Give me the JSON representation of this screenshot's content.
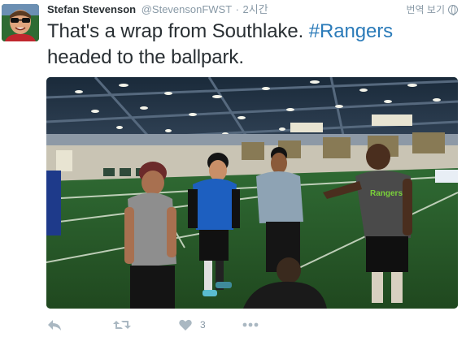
{
  "tweet": {
    "author_name": "Stefan Stevenson",
    "author_handle": "@StevensonFWST",
    "separator": "·",
    "timestamp": "2시간",
    "translate_label": "번역 보기",
    "text_part1": "That's a wrap from Southlake. ",
    "hashtag": "#Rangers",
    "text_part2": "headed to the ballpark.",
    "shirt_text": "Rangers"
  },
  "actions": {
    "reply_icon": "reply-icon",
    "retweet_icon": "retweet-icon",
    "like_icon": "heart-icon",
    "like_count": "3",
    "more_icon": "more-icon"
  },
  "colors": {
    "text": "#292f33",
    "secondary": "#8899a6",
    "hashtag": "#2b7bb9",
    "action_icon": "#aab8c2"
  }
}
